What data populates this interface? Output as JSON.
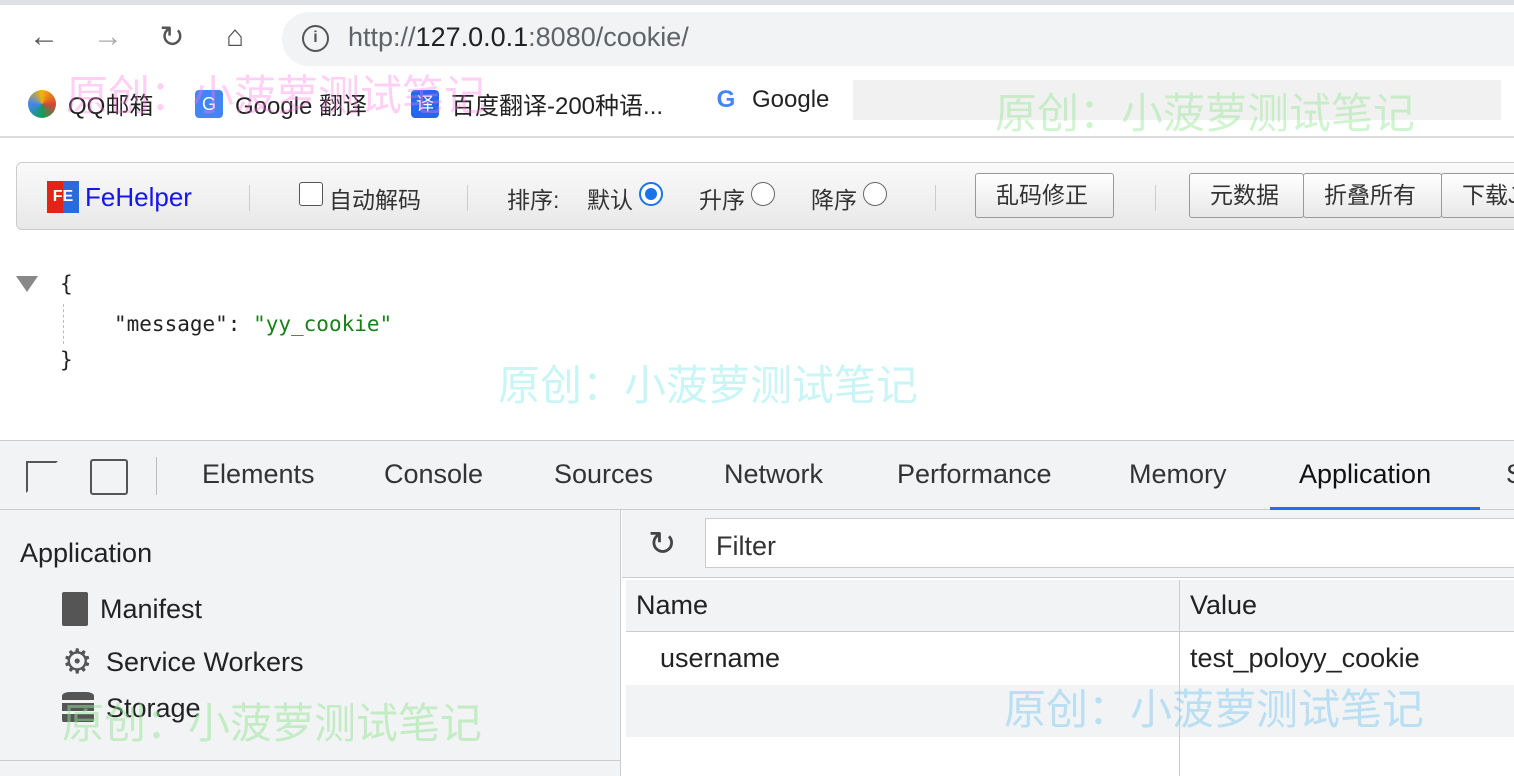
{
  "browser": {
    "url_prefix": "http://",
    "url_host": "127.0.0.1",
    "url_rest": ":8080/cookie/",
    "bookmarks": [
      {
        "label": "QQ邮箱",
        "icon": "qq-mail-icon"
      },
      {
        "label": "Google 翻译",
        "icon": "google-translate-icon"
      },
      {
        "label": "百度翻译-200种语...",
        "icon": "baidu-translate-icon"
      },
      {
        "label": "Google",
        "icon": "google-icon"
      }
    ]
  },
  "fehelper": {
    "brand": "FeHelper",
    "logo": "FE",
    "auto_decode": "自动解码",
    "sort_label": "排序:",
    "sort_default": "默认",
    "sort_asc": "升序",
    "sort_desc": "降序",
    "fix_button": "乱码修正",
    "meta_button": "元数据",
    "collapse_button": "折叠所有",
    "download_button": "下载JSON"
  },
  "json": {
    "open": "{",
    "key": "\"message\"",
    "colon": ": ",
    "value": "\"yy_cookie\"",
    "close": "}"
  },
  "devtools": {
    "tabs": [
      "Elements",
      "Console",
      "Sources",
      "Network",
      "Performance",
      "Memory",
      "Application",
      "S"
    ],
    "active_tab": "Application",
    "sidebar": {
      "heading": "Application",
      "items": [
        "Manifest",
        "Service Workers",
        "Storage"
      ]
    },
    "filter_placeholder": "Filter",
    "table": {
      "columns": [
        "Name",
        "Value"
      ],
      "rows": [
        [
          "username",
          "test_poloyy_cookie"
        ]
      ]
    }
  },
  "watermark": "原创：小菠萝测试笔记",
  "colors": {
    "accent": "#1a73e8",
    "string": "#1a7f1a"
  }
}
